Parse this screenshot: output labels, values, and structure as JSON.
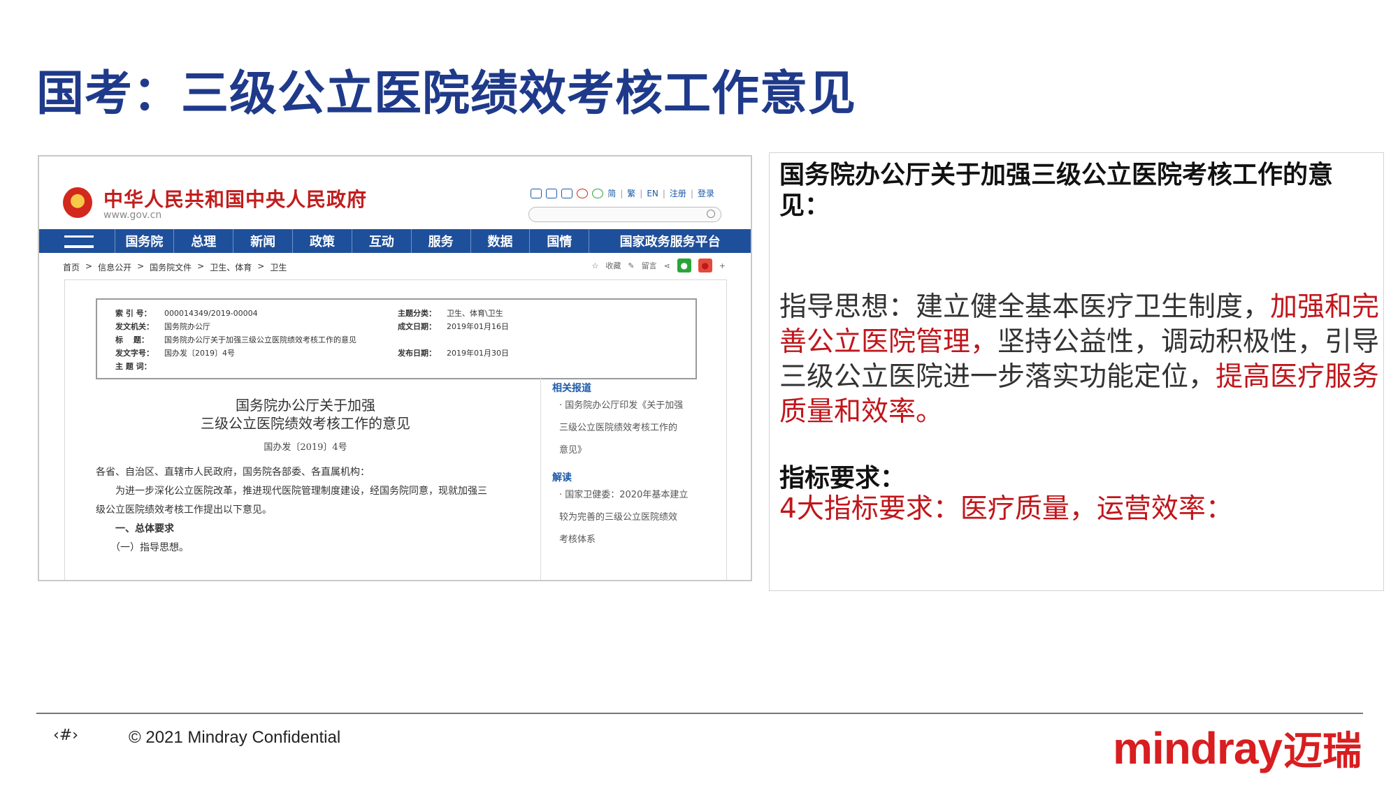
{
  "slide": {
    "title": "国考：三级公立医院绩效考核工作意见"
  },
  "screenshot": {
    "site_name": "中华人民共和国中央人民政府",
    "site_url": "www.gov.cn",
    "top_links": [
      "简",
      "繁",
      "EN",
      "注册",
      "登录"
    ],
    "nav": [
      "国务院",
      "总理",
      "新闻",
      "政策",
      "互动",
      "服务",
      "数据",
      "国情",
      "国家政务服务平台"
    ],
    "breadcrumbs": [
      "首页",
      ">",
      "信息公开",
      ">",
      "国务院文件",
      ">",
      "卫生、体育",
      ">",
      "卫生"
    ],
    "tools": [
      "收藏",
      "留言"
    ],
    "meta_left": [
      {
        "k": "索 引 号：",
        "v": "000014349/2019-00004"
      },
      {
        "k": "发文机关：",
        "v": "国务院办公厅"
      },
      {
        "k": "标　 题：",
        "v": "国务院办公厅关于加强三级公立医院绩效考核工作的意见"
      },
      {
        "k": "发文字号：",
        "v": "国办发〔2019〕4号"
      },
      {
        "k": "主 题 词：",
        "v": ""
      }
    ],
    "meta_right": [
      {
        "k": "主题分类：",
        "v": "卫生、体育\\卫生"
      },
      {
        "k": "成文日期：",
        "v": "2019年01月16日"
      },
      {
        "k": "",
        "v": ""
      },
      {
        "k": "发布日期：",
        "v": "2019年01月30日"
      }
    ],
    "doc_title_line1": "国务院办公厅关于加强",
    "doc_title_line2": "三级公立医院绩效考核工作的意见",
    "doc_number": "国办发〔2019〕4号",
    "body": [
      "各省、自治区、直辖市人民政府，国务院各部委、各直属机构：",
      "　　为进一步深化公立医院改革，推进现代医院管理制度建设，经国务院同意，现就加强三",
      "级公立医院绩效考核工作提出以下意见。",
      "　　一、总体要求",
      "　　（一）指导思想。"
    ],
    "side": {
      "head1": "相关报道",
      "items1": [
        "· 国务院办公厅印发《关于加强",
        "三级公立医院绩效考核工作的",
        "意见》"
      ],
      "head2": "解读",
      "items2": [
        "· 国家卫健委：2020年基本建立",
        "较为完善的三级公立医院绩效",
        "考核体系"
      ]
    }
  },
  "info": {
    "heading": "国务院办公厅关于加强三级公立医院考核工作的意见：",
    "p1": "指导思想：建立健全基本医疗卫生制度，",
    "p1_red": "加强和完善公立医院管理，",
    "p2": "坚持公益性，调动积极性，引导三级公立医院进一步落实功能定位，",
    "p2_red": "提高医疗服务质量和效率。",
    "sub": "指标要求：",
    "req": "4大指标要求：医疗质量，运营效率："
  },
  "footer": {
    "page": "‹#›",
    "copyright": "© 2021 Mindray Confidential",
    "brand_en": "mindray",
    "brand_cn": "迈瑞"
  },
  "colors": {
    "title": "#1f3a8a",
    "accent_red": "#c0161b",
    "nav_blue": "#1e4f9a",
    "brand": "#d81e20"
  }
}
